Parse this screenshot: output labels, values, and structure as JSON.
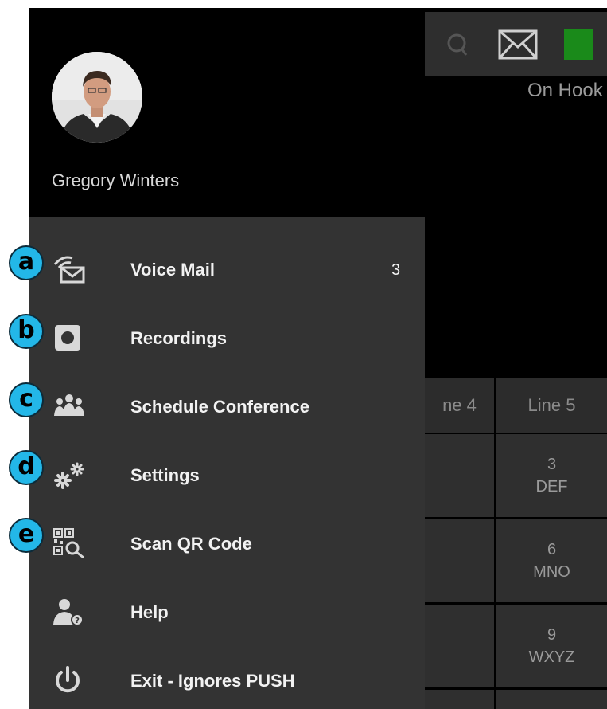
{
  "profile": {
    "name": "Gregory Winters"
  },
  "menu": {
    "items": [
      {
        "label": "Voice Mail",
        "badge": "3",
        "icon": "voicemail-icon"
      },
      {
        "label": "Recordings",
        "icon": "recordings-icon"
      },
      {
        "label": "Schedule Conference",
        "icon": "group-icon"
      },
      {
        "label": "Settings",
        "icon": "gears-icon"
      },
      {
        "label": "Scan QR Code",
        "icon": "qr-scan-icon"
      },
      {
        "label": "Help",
        "icon": "help-person-icon"
      },
      {
        "label": "Exit - Ignores PUSH",
        "icon": "power-icon"
      }
    ]
  },
  "callouts": [
    "a",
    "b",
    "c",
    "d",
    "e"
  ],
  "background": {
    "status": "On Hook",
    "lines": [
      "ne 4",
      "Line 5"
    ],
    "keys": [
      {
        "digit": "3",
        "letters": "DEF"
      },
      {
        "digit": "6",
        "letters": "MNO"
      },
      {
        "digit": "9",
        "letters": "WXYZ"
      }
    ]
  },
  "colors": {
    "drawer_bg": "#333333",
    "header_bg": "#000000",
    "callout": "#23b7e8",
    "status_green": "#1a8a1a"
  }
}
